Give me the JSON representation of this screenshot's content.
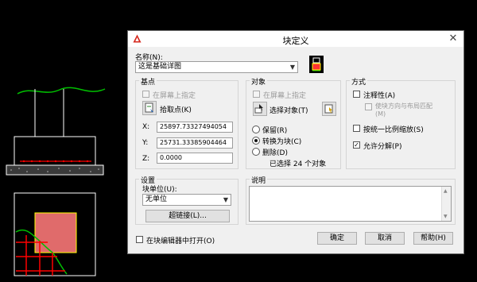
{
  "dialog": {
    "title": "块定义",
    "name_label": "名称(N):",
    "name_value": "这是基础详图",
    "base_point": {
      "group_label": "基点",
      "specify_on_screen": "在屏幕上指定",
      "pick_point": "拾取点(K)",
      "x_label": "X:",
      "x_value": "25897.73327494054",
      "y_label": "Y:",
      "y_value": "25731.33385904464",
      "z_label": "Z:",
      "z_value": "0.0000"
    },
    "objects": {
      "group_label": "对象",
      "specify_on_screen": "在屏幕上指定",
      "select_objects": "选择对象(T)",
      "retain": "保留(R)",
      "convert_to_block": "转换为块(C)",
      "delete": "删除(D)",
      "selected_count": "已选择 24 个对象"
    },
    "behavior": {
      "group_label": "方式",
      "annotative": "注释性(A)",
      "match_orientation": "使块方向与布局匹配(M)",
      "scale_uniformly": "按统一比例缩放(S)",
      "allow_exploding": "允许分解(P)",
      "annotative_checked": false,
      "scale_uniformly_checked": false,
      "allow_exploding_checked": true
    },
    "settings": {
      "group_label": "设置",
      "block_unit_label": "块单位(U):",
      "block_unit_value": "无单位",
      "hyperlink": "超链接(L)..."
    },
    "description": {
      "group_label": "说明"
    },
    "open_in_editor": "在块编辑器中打开(O)",
    "buttons": {
      "ok": "确定",
      "cancel": "取消",
      "help": "帮助(H)"
    }
  },
  "colors": {
    "background": "#000000",
    "rebar": "#ff0000",
    "ground_line": "#00c000",
    "hatch_fill": "#e06b6b",
    "outline": "#ffffff",
    "boundary": "#ffff00"
  }
}
